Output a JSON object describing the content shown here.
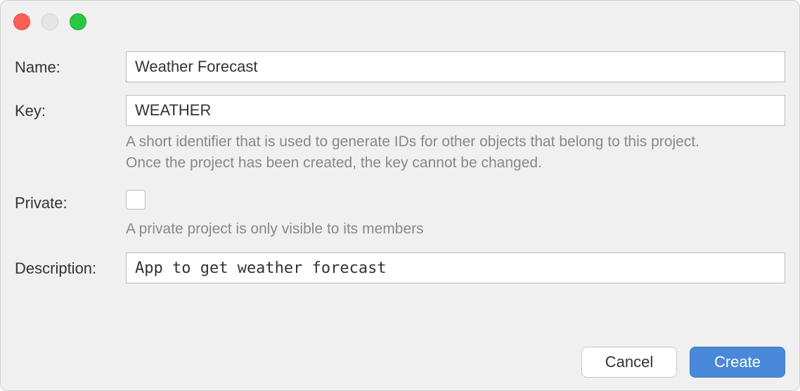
{
  "form": {
    "name": {
      "label": "Name:",
      "value": "Weather Forecast"
    },
    "key": {
      "label": "Key:",
      "value": "WEATHER",
      "help_line1": "A short identifier that is used to generate IDs for other objects that belong to this project.",
      "help_line2": "Once the project has been created, the key cannot be changed."
    },
    "private": {
      "label": "Private:",
      "help": "A private project is only visible to its members"
    },
    "description": {
      "label": "Description:",
      "value": "App to get weather forecast"
    }
  },
  "buttons": {
    "cancel": "Cancel",
    "create": "Create"
  }
}
